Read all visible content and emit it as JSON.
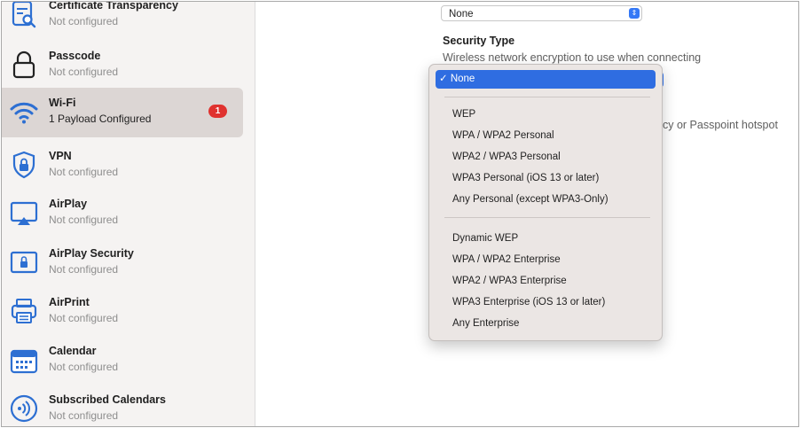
{
  "sidebar": {
    "items": [
      {
        "title": "Certificate Transparency",
        "subtitle": "Not configured",
        "icon": "certificate-search-icon"
      },
      {
        "title": "Passcode",
        "subtitle": "Not configured",
        "icon": "lock-icon"
      },
      {
        "title": "Wi-Fi",
        "subtitle": "1 Payload Configured",
        "icon": "wifi-icon",
        "badge": "1",
        "selected": true
      },
      {
        "title": "VPN",
        "subtitle": "Not configured",
        "icon": "vpn-shield-icon"
      },
      {
        "title": "AirPlay",
        "subtitle": "Not configured",
        "icon": "airplay-icon"
      },
      {
        "title": "AirPlay Security",
        "subtitle": "Not configured",
        "icon": "airplay-security-lock-icon"
      },
      {
        "title": "AirPrint",
        "subtitle": "Not configured",
        "icon": "printer-icon"
      },
      {
        "title": "Calendar",
        "subtitle": "Not configured",
        "icon": "calendar-icon"
      },
      {
        "title": "Subscribed Calendars",
        "subtitle": "Not configured",
        "icon": "subscribed-calendar-icon"
      }
    ]
  },
  "main": {
    "top_popup_value": "None",
    "security_type_label": "Security Type",
    "security_type_description": "Wireless network encryption to use when connecting",
    "clipped_text": "cy or Passpoint hotspot"
  },
  "security_menu": {
    "selected": "✓ None",
    "group1": [
      "WEP",
      "WPA / WPA2 Personal",
      "WPA2 / WPA3 Personal",
      "WPA3 Personal (iOS 13 or later)",
      "Any Personal (except WPA3-Only)"
    ],
    "group2": [
      "Dynamic WEP",
      "WPA / WPA2 Enterprise",
      "WPA2 / WPA3 Enterprise",
      "WPA3 Enterprise (iOS 13 or later)",
      "Any Enterprise"
    ]
  },
  "colors": {
    "accent": "#2f6de1",
    "badge": "#e0322f",
    "icon_blue": "#2d6fd2",
    "selected_row": "#dcd6d4"
  }
}
